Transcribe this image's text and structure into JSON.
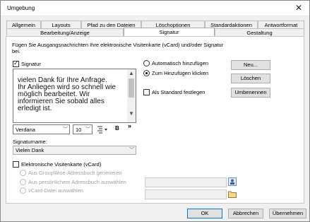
{
  "window": {
    "title": "Umgebung",
    "close_glyph": "✕"
  },
  "tabs_row1": [
    "Allgemein",
    "Layouts",
    "Pfad zu den Dateien",
    "Löschoptionen",
    "Standardaktionen",
    "Antwortformat"
  ],
  "tabs_row2": [
    "Bearbeitung/Anzeige",
    "Signatur",
    "Gestaltung"
  ],
  "active_tab": "Signatur",
  "intro": {
    "line1": "Fügen Sie Ausgangsnachrichten Ihre elektronische Visitenkarte (vCard) und/oder Signatur",
    "line2": "bei."
  },
  "signature": {
    "checkbox_label": "Signatur",
    "checked": true,
    "text": "vielen Dank für Ihre Anfrage.\nIhr Anliegen wird so schnell wie\nmöglich bearbeitet. Wir\ninformieren Sie sobald alles\nerledigt ist."
  },
  "options": {
    "auto_add_label": "Automatisch hinzufügen",
    "click_add_label": "Zum Hinzufügen klicken",
    "selected": "click_add",
    "default_label": "Als Standard festlegen",
    "default_checked": false
  },
  "buttons": {
    "new": "Neu...",
    "delete": "Löschen",
    "rename": "Umbenennen"
  },
  "format": {
    "font": "Verdana",
    "size": "10",
    "bold": "B",
    "more": "»"
  },
  "signature_name": {
    "label": "Signaturname:",
    "value": "Vielen Dank"
  },
  "vcard": {
    "checkbox_label": "Elektronische Visitenkarte (vCard)",
    "checked": false,
    "opt1": "Aus GroupWise-Adressbuch generieren",
    "opt2": "Aus persönlichem Adressbuch auswählen",
    "opt3": "vCard-Datei auswählen"
  },
  "footer": {
    "ok": "OK",
    "cancel": "Abbrechen",
    "apply": "Übernehmen"
  }
}
